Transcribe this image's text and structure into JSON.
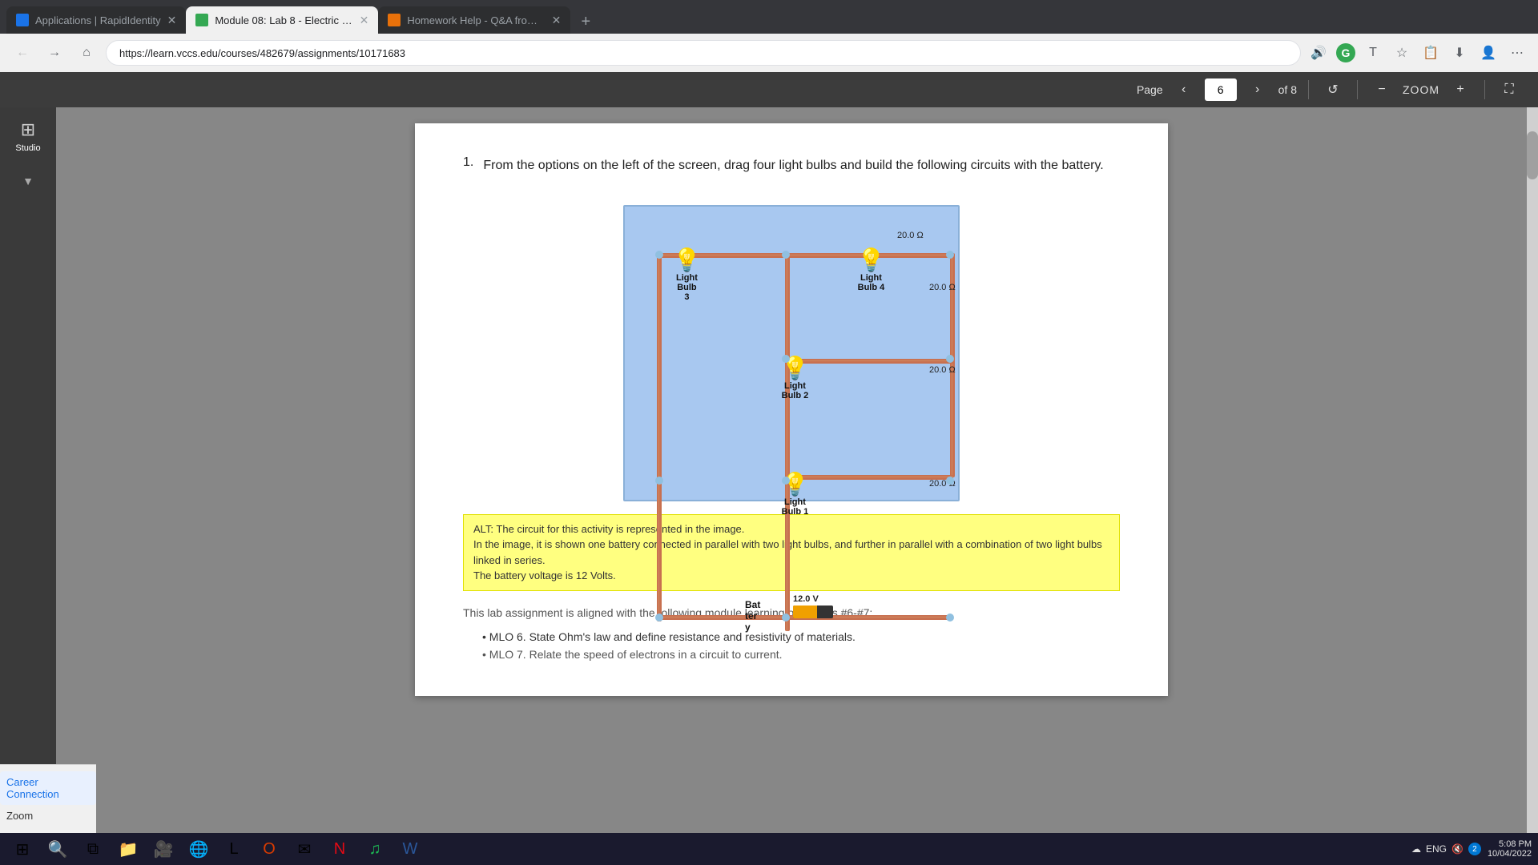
{
  "browser": {
    "tabs": [
      {
        "id": "tab1",
        "label": "Applications | RapidIdentity",
        "favicon": "blue",
        "active": false
      },
      {
        "id": "tab2",
        "label": "Module 08: Lab 8 - Electric Circu...",
        "favicon": "green",
        "active": true
      },
      {
        "id": "tab3",
        "label": "Homework Help - Q&A from On...",
        "favicon": "hw",
        "active": false
      }
    ],
    "address": "https://learn.vccs.edu/courses/482679/assignments/10171683"
  },
  "toolbar": {
    "page_label": "Page",
    "current_page": "6",
    "total_pages": "of 8",
    "zoom_label": "ZOOM"
  },
  "sidebar": {
    "studio_label": "Studio",
    "items": [
      {
        "label": "Career Connection"
      },
      {
        "label": "Zoom"
      }
    ]
  },
  "content": {
    "instruction_number": "1.",
    "instruction_text": "From the options on the left of the screen, drag four light bulbs and build the following circuits with the battery.",
    "circuit": {
      "resistance_labels": [
        "20.0 Ω",
        "20.0 Ω",
        "20.0 Ω",
        "20.0 Ω"
      ],
      "bulb_labels": [
        "Light Bulb 3",
        "Light Bulb 4",
        "Light Bulb 2",
        "Light Bulb 1"
      ],
      "battery_label": "Battery",
      "voltage": "12.0 V"
    },
    "alt_text_line1": "ALT: The circuit for this activity is represented in the image.",
    "alt_text_line2": "In the image, it is shown one battery connected in parallel with two light bulbs, and further in parallel with a combination of two light bulbs linked in series.",
    "alt_text_line3": "The battery voltage is 12 Volts.",
    "module_text": "This lab assignment is aligned with the following module learning objectives #6-#7:",
    "mlo_items": [
      "MLO 6. State Ohm's law and define resistance and resistivity of materials.",
      "MLO 7. Relate the speed of electrons in a circuit to current."
    ]
  },
  "taskbar": {
    "time": "5:08 PM",
    "date": "10/04/2022",
    "sys_text": "ENG",
    "notification_count": "2"
  }
}
